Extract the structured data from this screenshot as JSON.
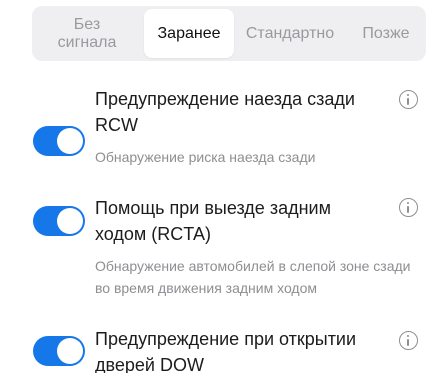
{
  "tabs": [
    {
      "label": "Без\nсигнала",
      "active": false
    },
    {
      "label": "Заранее",
      "active": true
    },
    {
      "label": "Стандартно",
      "active": false
    },
    {
      "label": "Позже",
      "active": false
    }
  ],
  "items": [
    {
      "title": "Предупреждение наезда сзади RCW",
      "description": "Обнаружение риска наезда сзади",
      "enabled": true
    },
    {
      "title": "Помощь при выезде задним ходом (RCTA)",
      "description": "Обнаружение автомобилей в слепой зоне сзади во время движения задним ходом",
      "enabled": true
    },
    {
      "title": "Предупреждение при открытии дверей DOW",
      "description": "",
      "enabled": true
    }
  ],
  "colors": {
    "accent": "#1678e8",
    "segment_bg": "#efeff1",
    "muted_text": "#8e8e93"
  },
  "icons": {
    "info": "info-icon"
  }
}
